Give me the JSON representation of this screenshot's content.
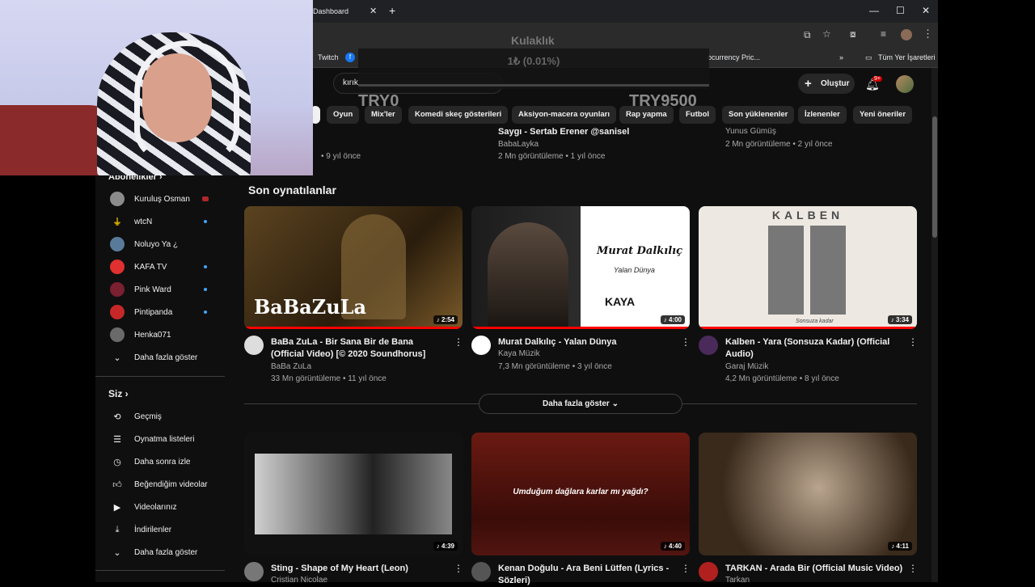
{
  "browser": {
    "tab_title": "Dashboard",
    "bookmarks": [
      "Twitch",
      "ocurrency Pric...",
      "Tüm Yer İşaretleri"
    ],
    "more_bookmarks": "»"
  },
  "overlay": {
    "title": "Kulaklık",
    "amount": "1₺ (0.01%)",
    "min": "TRY0",
    "max": "TRY9500",
    "progress_fraction": 0.0001
  },
  "youtube": {
    "search_value": "kırık",
    "create_label": "Oluştur",
    "notifications_badge": "9+",
    "chips": [
      "Oyun",
      "Mix'ler",
      "Komedi skeç gösterileri",
      "Aksiyon-macera oyunları",
      "Rap yapma",
      "Futbol",
      "Son yüklenenler",
      "İzlenenler",
      "Yeni öneriler"
    ]
  },
  "sidebar": {
    "subs_header": "Abonelikler",
    "subscriptions": [
      {
        "name": "Kuruluş Osman",
        "badge": "live"
      },
      {
        "name": "wtcN",
        "badge": "dot"
      },
      {
        "name": "Noluyo Ya ¿",
        "badge": ""
      },
      {
        "name": "KAFA TV",
        "badge": "dot"
      },
      {
        "name": "Pink Ward",
        "badge": "dot"
      },
      {
        "name": "Pintipanda",
        "badge": "dot"
      },
      {
        "name": "Henka071",
        "badge": ""
      }
    ],
    "show_more": "Daha fazla göster",
    "you_header": "Siz",
    "you_items": [
      "Geçmiş",
      "Oynatma listeleri",
      "Daha sonra izle",
      "Beğendiğim videolar",
      "Videolarınız",
      "İndirilenler",
      "Daha fazla göster"
    ]
  },
  "top_row": [
    {
      "title": "Saygı - Sertab Erener @sanisel",
      "meta": "9 yıl önce",
      "channel": "BabaLayka",
      "views": "2 Mn görüntüleme • 1 yıl önce"
    },
    {
      "title": "Yunus Gümüş",
      "meta": "2 Mn görüntüleme • 2 yıl önce"
    }
  ],
  "top_left_meta": "• 9 yıl önce",
  "section_title": "Son oynatılanlar",
  "recent": [
    {
      "title": "BaBa ZuLa - Bir Sana Bir de Bana (Official Video) [© 2020 Soundhorus]",
      "channel": "BaBa ZuLa",
      "meta": "33 Mn görüntüleme • 11 yıl önce",
      "duration": "2:54",
      "thumb_text": "BaBaZuLa",
      "watched": 1.0
    },
    {
      "title": "Murat Dalkılıç - Yalan Dünya",
      "channel": "Kaya Müzik",
      "meta": "7,3 Mn görüntüleme • 3 yıl önce",
      "duration": "4:00",
      "thumb_text": "Murat Dalkılıç",
      "thumb_sub": "Yalan Dünya",
      "thumb_logo": "KAYA",
      "watched": 1.0
    },
    {
      "title": "Kalben - Yara (Sonsuza Kadar) (Official Audio)",
      "channel": "Garaj Müzik",
      "meta": "4,2 Mn görüntüleme • 8 yıl önce",
      "duration": "3:34",
      "thumb_text": "KALBEN",
      "thumb_sub": "Sonsuza kadar",
      "watched": 1.0
    }
  ],
  "more_button": "Daha fazla göster",
  "bottom": [
    {
      "title": "Sting - Shape of My Heart (Leon)",
      "channel": "Cristian Nicolae",
      "duration": "4:39"
    },
    {
      "title": "Kenan Doğulu - Ara Beni Lütfen (Lyrics - Sözleri)",
      "duration": "4:40",
      "thumb_text": "Umduğum dağlara karlar mı yağdı?"
    },
    {
      "title": "TARKAN - Arada Bir (Official Music Video)",
      "channel": "Tarkan",
      "duration": "4:11"
    }
  ],
  "colors": {
    "bg": "#0f0f0f",
    "accent": "#ff0000",
    "link": "#3ea6ff"
  }
}
